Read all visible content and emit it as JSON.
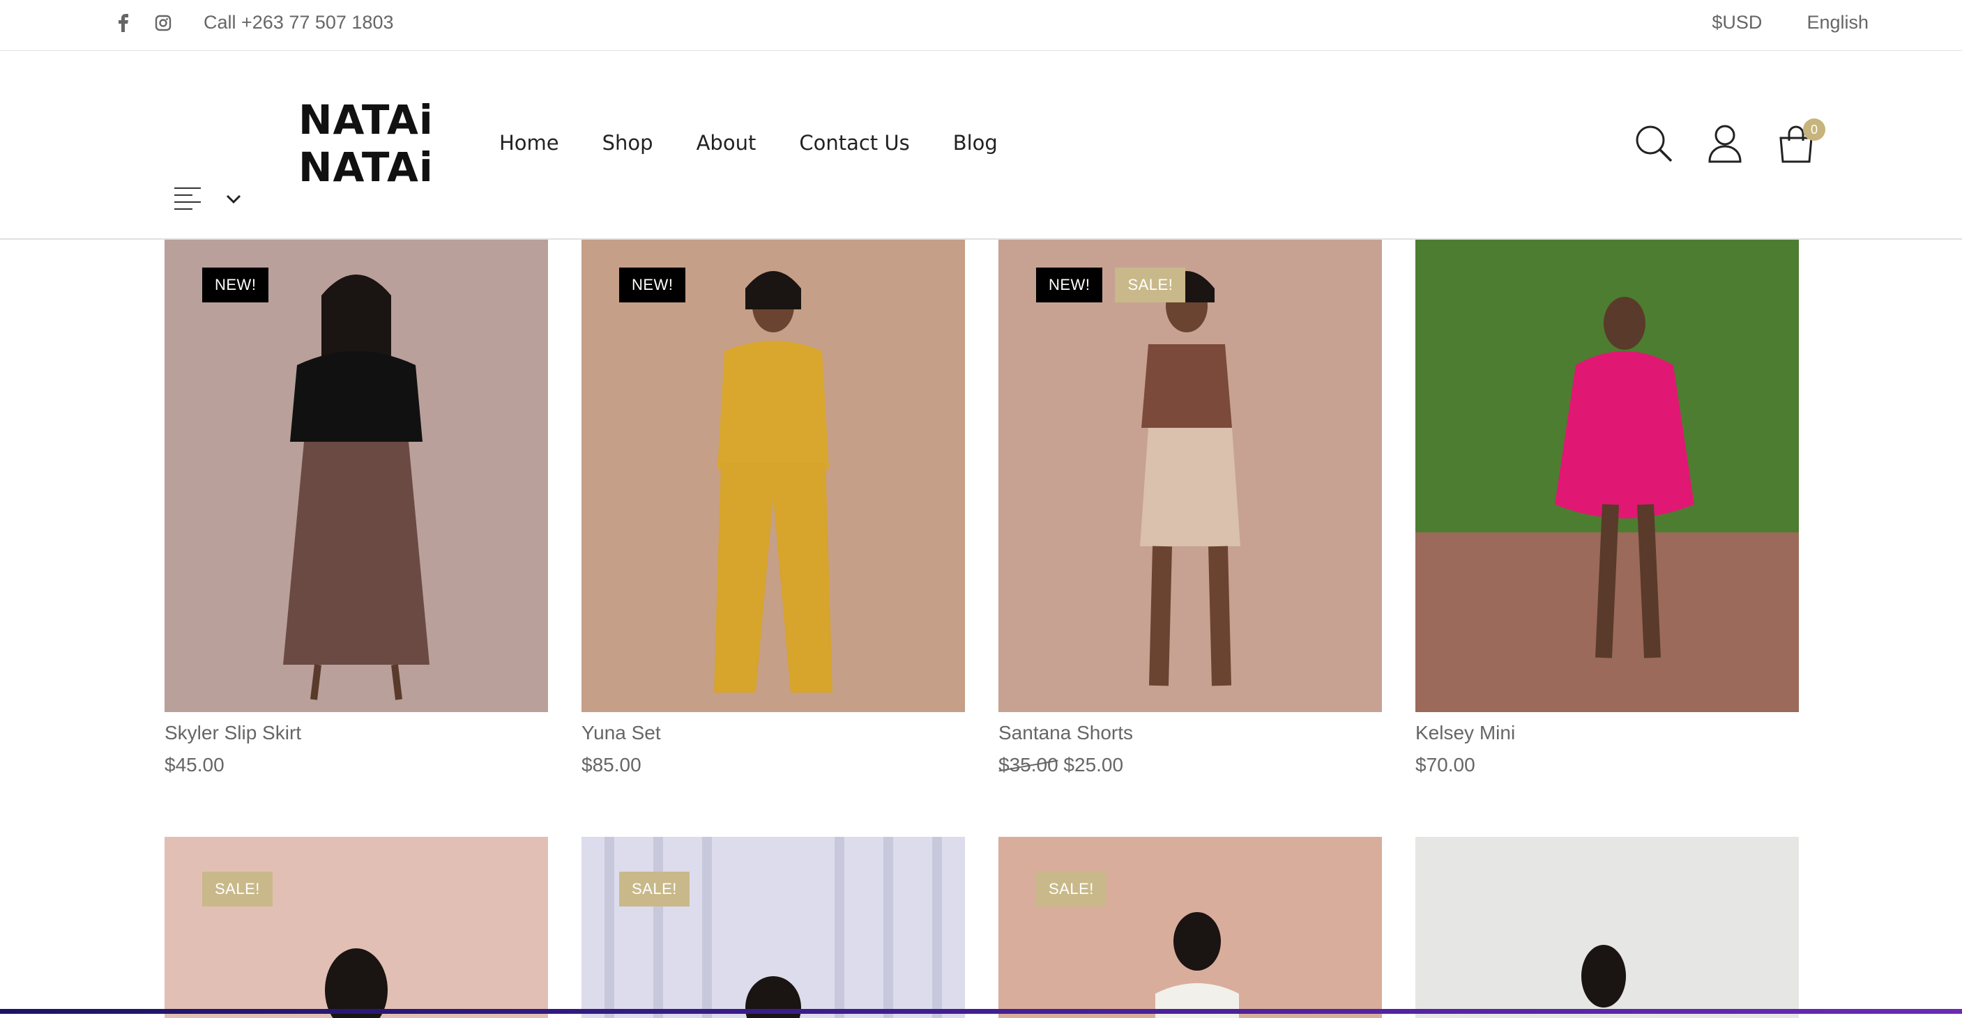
{
  "topbar": {
    "phone": "Call +263 77 507 1803",
    "currency": "$USD",
    "language": "English",
    "social_icons": [
      "facebook-icon",
      "instagram-icon"
    ]
  },
  "header": {
    "logo_line1": "NATAi",
    "logo_line2": "NATAi",
    "nav": [
      "Home",
      "Shop",
      "About",
      "Contact Us",
      "Blog"
    ],
    "cart_count": "0",
    "icons": [
      "search-icon",
      "user-icon",
      "cart-icon",
      "menu-icon",
      "chevron-down-icon"
    ]
  },
  "products": [
    {
      "name": "Skyler Slip Skirt",
      "price": "$45.00",
      "badges": [
        "NEW!"
      ]
    },
    {
      "name": "Yuna Set",
      "price": "$85.00",
      "badges": [
        "NEW!"
      ]
    },
    {
      "name": "Santana Shorts",
      "old_price": "$35.00",
      "price": "$25.00",
      "badges": [
        "NEW!",
        "SALE!"
      ]
    },
    {
      "name": "Kelsey Mini",
      "price": "$70.00",
      "badges": []
    }
  ],
  "products_row2": [
    {
      "badges": [
        "SALE!"
      ]
    },
    {
      "badges": [
        "SALE!"
      ]
    },
    {
      "badges": [
        "SALE!"
      ]
    },
    {
      "badges": []
    }
  ],
  "colors": {
    "sale_badge": "#c9b98a",
    "new_badge": "#000000",
    "cart_badge": "#c7b47c"
  }
}
